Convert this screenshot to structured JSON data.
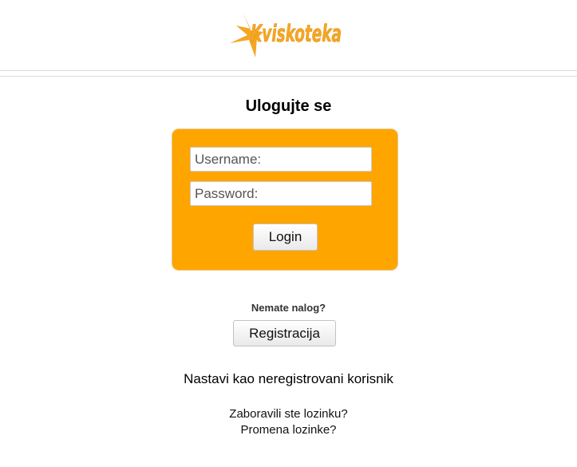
{
  "header": {
    "logo_text": "Kviskoteka",
    "logo_color": "#f5a623"
  },
  "login": {
    "title": "Ulogujte se",
    "username_placeholder": "Username:",
    "password_placeholder": "Password:",
    "username_value": "",
    "password_value": "",
    "login_label": "Login",
    "box_color": "#ffa500"
  },
  "register": {
    "prompt": "Nemate nalog?",
    "button_label": "Registracija"
  },
  "guest": {
    "label": "Nastavi kao neregistrovani korisnik"
  },
  "links": {
    "forgot_password": "Zaboravili ste lozinku?",
    "change_password": "Promena lozinke?"
  }
}
